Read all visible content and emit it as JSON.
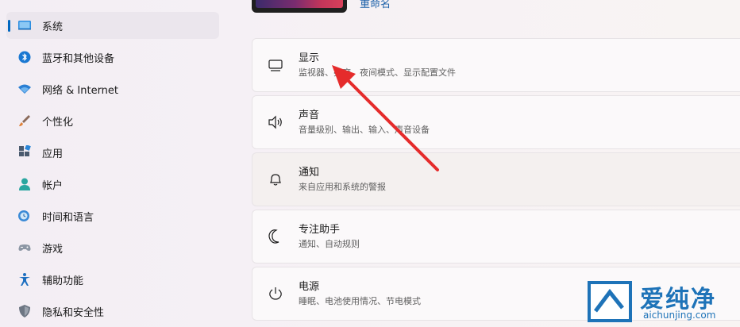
{
  "sidebar": {
    "items": [
      {
        "label": "系统",
        "icon": "system-icon",
        "active": true
      },
      {
        "label": "蓝牙和其他设备",
        "icon": "bluetooth-icon"
      },
      {
        "label": "网络 & Internet",
        "icon": "wifi-icon"
      },
      {
        "label": "个性化",
        "icon": "brush-icon"
      },
      {
        "label": "应用",
        "icon": "apps-icon"
      },
      {
        "label": "帐户",
        "icon": "account-icon"
      },
      {
        "label": "时间和语言",
        "icon": "globe-clock-icon"
      },
      {
        "label": "游戏",
        "icon": "gamepad-icon"
      },
      {
        "label": "辅助功能",
        "icon": "accessibility-icon"
      },
      {
        "label": "隐私和安全性",
        "icon": "shield-icon"
      }
    ]
  },
  "device": {
    "rename_label": "重命名"
  },
  "cards": [
    {
      "title": "显示",
      "desc": "监视器、亮度、夜间模式、显示配置文件",
      "icon": "monitor-icon"
    },
    {
      "title": "声音",
      "desc": "音量级别、输出、输入、声音设备",
      "icon": "speaker-icon"
    },
    {
      "title": "通知",
      "desc": "来自应用和系统的警报",
      "icon": "bell-icon"
    },
    {
      "title": "专注助手",
      "desc": "通知、自动规则",
      "icon": "moon-icon"
    },
    {
      "title": "电源",
      "desc": "睡眠、电池使用情况、节电模式",
      "icon": "power-icon"
    }
  ],
  "watermark": {
    "brand": "爱纯净",
    "url": "aichunjing.com"
  },
  "colors": {
    "accent": "#0067c0",
    "annotation_arrow": "#e52b2b",
    "watermark": "#1e73b8"
  }
}
